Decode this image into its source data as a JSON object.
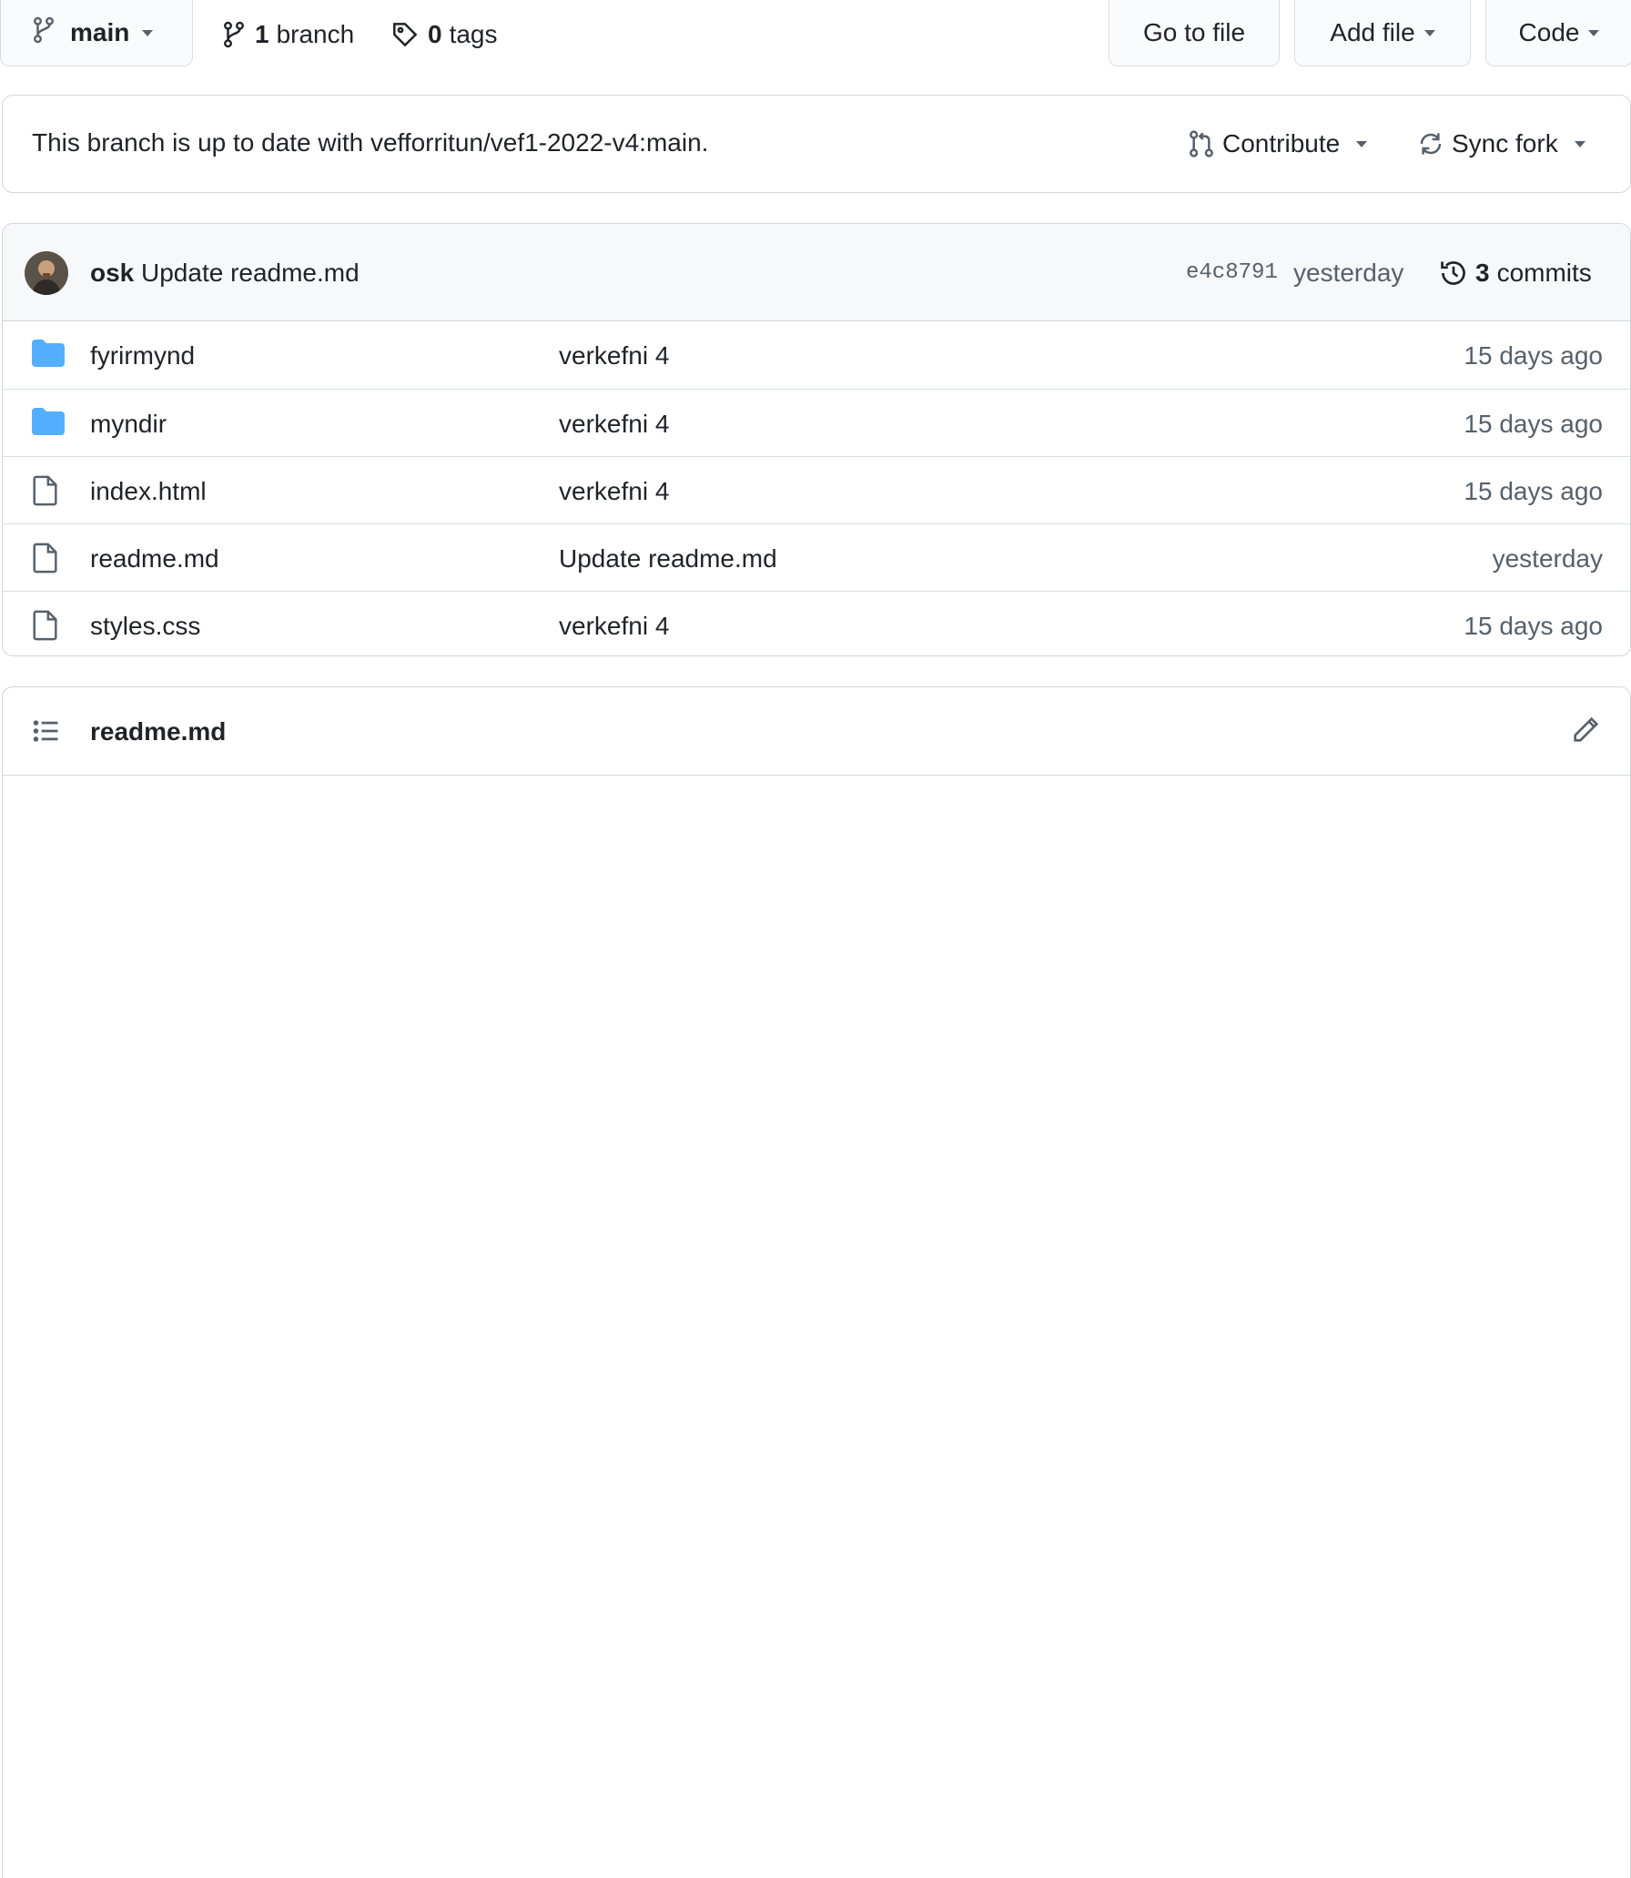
{
  "toolbar": {
    "branch_name": "main",
    "branch_count": "1",
    "branch_label": "branch",
    "tag_count": "0",
    "tag_label": "tags",
    "go_to_file": "Go to file",
    "add_file": "Add file",
    "code": "Code"
  },
  "sync": {
    "status_text": "This branch is up to date with vefforritun/vef1-2022-v4:main.",
    "contribute": "Contribute",
    "sync_fork": "Sync fork"
  },
  "commit": {
    "author": "osk",
    "message": "Update readme.md",
    "sha": "e4c8791",
    "time": "yesterday",
    "count": "3",
    "count_label": "commits"
  },
  "files": [
    {
      "type": "folder",
      "icon": "folder-icon",
      "name": "fyrirmynd",
      "commit": "verkefni 4",
      "time": "15 days ago"
    },
    {
      "type": "folder",
      "icon": "folder-icon",
      "name": "myndir",
      "commit": "verkefni 4",
      "time": "15 days ago"
    },
    {
      "type": "file",
      "icon": "file-icon",
      "name": "index.html",
      "commit": "verkefni 4",
      "time": "15 days ago"
    },
    {
      "type": "file",
      "icon": "file-icon",
      "name": "readme.md",
      "commit": "Update readme.md",
      "time": "yesterday"
    },
    {
      "type": "file",
      "icon": "file-icon",
      "name": "styles.css",
      "commit": "verkefni 4",
      "time": "15 days ago"
    }
  ],
  "readme": {
    "title": "readme.md"
  },
  "colors": {
    "folder": "#54aeff",
    "border": "#d0d7de",
    "muted_text": "#57606a",
    "header_bg": "#f6f8fa"
  }
}
